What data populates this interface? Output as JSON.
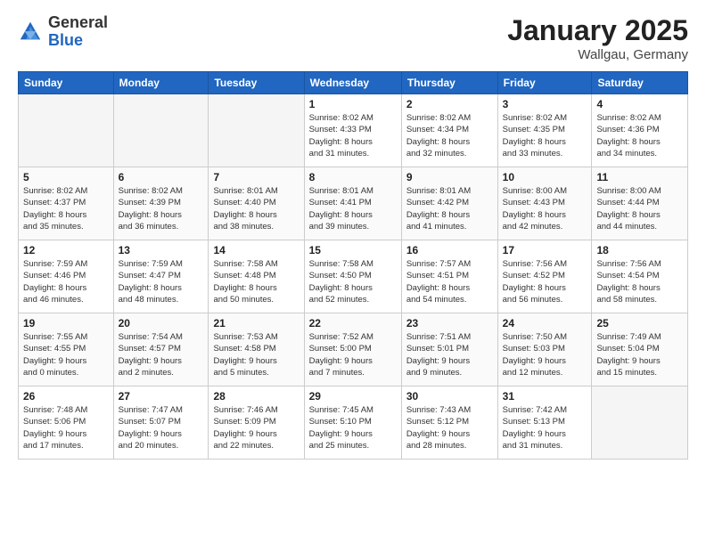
{
  "header": {
    "logo_general": "General",
    "logo_blue": "Blue",
    "title": "January 2025",
    "subtitle": "Wallgau, Germany"
  },
  "weekdays": [
    "Sunday",
    "Monday",
    "Tuesday",
    "Wednesday",
    "Thursday",
    "Friday",
    "Saturday"
  ],
  "weeks": [
    [
      {
        "day": "",
        "detail": ""
      },
      {
        "day": "",
        "detail": ""
      },
      {
        "day": "",
        "detail": ""
      },
      {
        "day": "1",
        "detail": "Sunrise: 8:02 AM\nSunset: 4:33 PM\nDaylight: 8 hours\nand 31 minutes."
      },
      {
        "day": "2",
        "detail": "Sunrise: 8:02 AM\nSunset: 4:34 PM\nDaylight: 8 hours\nand 32 minutes."
      },
      {
        "day": "3",
        "detail": "Sunrise: 8:02 AM\nSunset: 4:35 PM\nDaylight: 8 hours\nand 33 minutes."
      },
      {
        "day": "4",
        "detail": "Sunrise: 8:02 AM\nSunset: 4:36 PM\nDaylight: 8 hours\nand 34 minutes."
      }
    ],
    [
      {
        "day": "5",
        "detail": "Sunrise: 8:02 AM\nSunset: 4:37 PM\nDaylight: 8 hours\nand 35 minutes."
      },
      {
        "day": "6",
        "detail": "Sunrise: 8:02 AM\nSunset: 4:39 PM\nDaylight: 8 hours\nand 36 minutes."
      },
      {
        "day": "7",
        "detail": "Sunrise: 8:01 AM\nSunset: 4:40 PM\nDaylight: 8 hours\nand 38 minutes."
      },
      {
        "day": "8",
        "detail": "Sunrise: 8:01 AM\nSunset: 4:41 PM\nDaylight: 8 hours\nand 39 minutes."
      },
      {
        "day": "9",
        "detail": "Sunrise: 8:01 AM\nSunset: 4:42 PM\nDaylight: 8 hours\nand 41 minutes."
      },
      {
        "day": "10",
        "detail": "Sunrise: 8:00 AM\nSunset: 4:43 PM\nDaylight: 8 hours\nand 42 minutes."
      },
      {
        "day": "11",
        "detail": "Sunrise: 8:00 AM\nSunset: 4:44 PM\nDaylight: 8 hours\nand 44 minutes."
      }
    ],
    [
      {
        "day": "12",
        "detail": "Sunrise: 7:59 AM\nSunset: 4:46 PM\nDaylight: 8 hours\nand 46 minutes."
      },
      {
        "day": "13",
        "detail": "Sunrise: 7:59 AM\nSunset: 4:47 PM\nDaylight: 8 hours\nand 48 minutes."
      },
      {
        "day": "14",
        "detail": "Sunrise: 7:58 AM\nSunset: 4:48 PM\nDaylight: 8 hours\nand 50 minutes."
      },
      {
        "day": "15",
        "detail": "Sunrise: 7:58 AM\nSunset: 4:50 PM\nDaylight: 8 hours\nand 52 minutes."
      },
      {
        "day": "16",
        "detail": "Sunrise: 7:57 AM\nSunset: 4:51 PM\nDaylight: 8 hours\nand 54 minutes."
      },
      {
        "day": "17",
        "detail": "Sunrise: 7:56 AM\nSunset: 4:52 PM\nDaylight: 8 hours\nand 56 minutes."
      },
      {
        "day": "18",
        "detail": "Sunrise: 7:56 AM\nSunset: 4:54 PM\nDaylight: 8 hours\nand 58 minutes."
      }
    ],
    [
      {
        "day": "19",
        "detail": "Sunrise: 7:55 AM\nSunset: 4:55 PM\nDaylight: 9 hours\nand 0 minutes."
      },
      {
        "day": "20",
        "detail": "Sunrise: 7:54 AM\nSunset: 4:57 PM\nDaylight: 9 hours\nand 2 minutes."
      },
      {
        "day": "21",
        "detail": "Sunrise: 7:53 AM\nSunset: 4:58 PM\nDaylight: 9 hours\nand 5 minutes."
      },
      {
        "day": "22",
        "detail": "Sunrise: 7:52 AM\nSunset: 5:00 PM\nDaylight: 9 hours\nand 7 minutes."
      },
      {
        "day": "23",
        "detail": "Sunrise: 7:51 AM\nSunset: 5:01 PM\nDaylight: 9 hours\nand 9 minutes."
      },
      {
        "day": "24",
        "detail": "Sunrise: 7:50 AM\nSunset: 5:03 PM\nDaylight: 9 hours\nand 12 minutes."
      },
      {
        "day": "25",
        "detail": "Sunrise: 7:49 AM\nSunset: 5:04 PM\nDaylight: 9 hours\nand 15 minutes."
      }
    ],
    [
      {
        "day": "26",
        "detail": "Sunrise: 7:48 AM\nSunset: 5:06 PM\nDaylight: 9 hours\nand 17 minutes."
      },
      {
        "day": "27",
        "detail": "Sunrise: 7:47 AM\nSunset: 5:07 PM\nDaylight: 9 hours\nand 20 minutes."
      },
      {
        "day": "28",
        "detail": "Sunrise: 7:46 AM\nSunset: 5:09 PM\nDaylight: 9 hours\nand 22 minutes."
      },
      {
        "day": "29",
        "detail": "Sunrise: 7:45 AM\nSunset: 5:10 PM\nDaylight: 9 hours\nand 25 minutes."
      },
      {
        "day": "30",
        "detail": "Sunrise: 7:43 AM\nSunset: 5:12 PM\nDaylight: 9 hours\nand 28 minutes."
      },
      {
        "day": "31",
        "detail": "Sunrise: 7:42 AM\nSunset: 5:13 PM\nDaylight: 9 hours\nand 31 minutes."
      },
      {
        "day": "",
        "detail": ""
      }
    ]
  ]
}
